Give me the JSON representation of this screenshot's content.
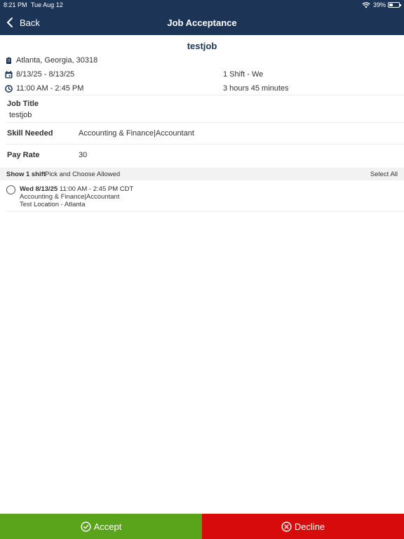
{
  "status_bar": {
    "time": "8:21 PM",
    "date": "Tue Aug 12",
    "battery_percent": "39%",
    "battery_level": 0.39
  },
  "nav": {
    "back_label": "Back",
    "title": "Job Acceptance"
  },
  "job": {
    "name": "testjob",
    "location": "Atlanta, Georgia, 30318",
    "date_range": "8/13/25 - 8/13/25",
    "shift_summary": "1 Shift - We",
    "time_range": "11:00 AM - 2:45 PM",
    "duration": "3 hours 45 minutes"
  },
  "details": {
    "job_title_label": "Job Title",
    "job_title_value": "testjob",
    "skill_label": "Skill Needed",
    "skill_value": "Accounting & Finance|Accountant",
    "pay_label": "Pay Rate",
    "pay_value": "30"
  },
  "shifts": {
    "show_label": "Show 1 shift",
    "pick_label": "Pick and Choose Allowed",
    "select_all_label": "Select All",
    "items": [
      {
        "day_date": "Wed 8/13/25",
        "time": "11:00 AM - 2:45 PM CDT",
        "skill": "Accounting & Finance|Accountant",
        "location": "Test Location - Atlanta",
        "selected": false
      }
    ]
  },
  "actions": {
    "accept_label": "Accept",
    "decline_label": "Decline",
    "accept_color": "#5aa41b",
    "decline_color": "#d70b0b",
    "header_color": "#1c3557"
  },
  "icons": [
    "wifi-icon",
    "battery-icon",
    "back-chevron-icon",
    "building-icon",
    "calendar-icon",
    "clock-icon",
    "radio-icon",
    "check-circle-icon",
    "x-circle-icon"
  ]
}
